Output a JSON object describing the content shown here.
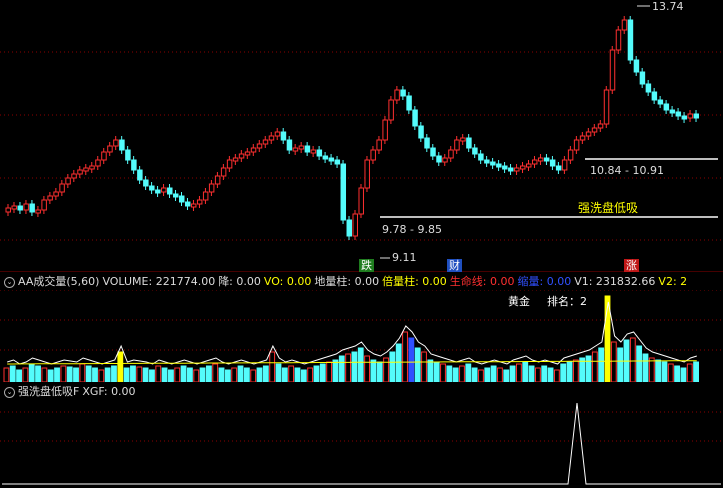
{
  "price_panel": {
    "high_label": "13.74",
    "low_label": "9.11",
    "range_low": "9.78 - 9.85",
    "range_high": "10.84 - 10.91",
    "strategy_label": "强洗盘低吸",
    "markers": {
      "fall": "跌",
      "finance": "财",
      "rise": "涨"
    }
  },
  "volume_panel": {
    "indicator_name": "AA成交量(5,60)",
    "fields": [
      {
        "label": "VOLUME: 221774.00",
        "color": "#dcdcdc"
      },
      {
        "label": "降: 0.00",
        "color": "#dcdcdc"
      },
      {
        "label": "VO: 0.00",
        "color": "#ffff00"
      },
      {
        "label": "地量柱: 0.00",
        "color": "#dcdcdc"
      },
      {
        "label": "倍量柱: 0.00",
        "color": "#ffff00"
      },
      {
        "label": "生命线: 0.00",
        "color": "#ff3030"
      },
      {
        "label": "缩量: 0.00",
        "color": "#3050ff"
      },
      {
        "label": "V1: 231832.66",
        "color": "#dcdcdc"
      },
      {
        "label": "V2: 2",
        "color": "#ffff00"
      }
    ],
    "tag_gold": "黄金",
    "tag_rank": "排名：2"
  },
  "signal_panel": {
    "indicator_name": "强洗盘低吸F",
    "value": "XGF: 0.00"
  },
  "icons": {
    "header_toggle": "circle-toggle-icon"
  },
  "colors": {
    "up": "#ff3030",
    "down": "#54fcfc",
    "signal": "#ffff00",
    "grid": "#8b0000",
    "guide": "#bebebe"
  }
}
